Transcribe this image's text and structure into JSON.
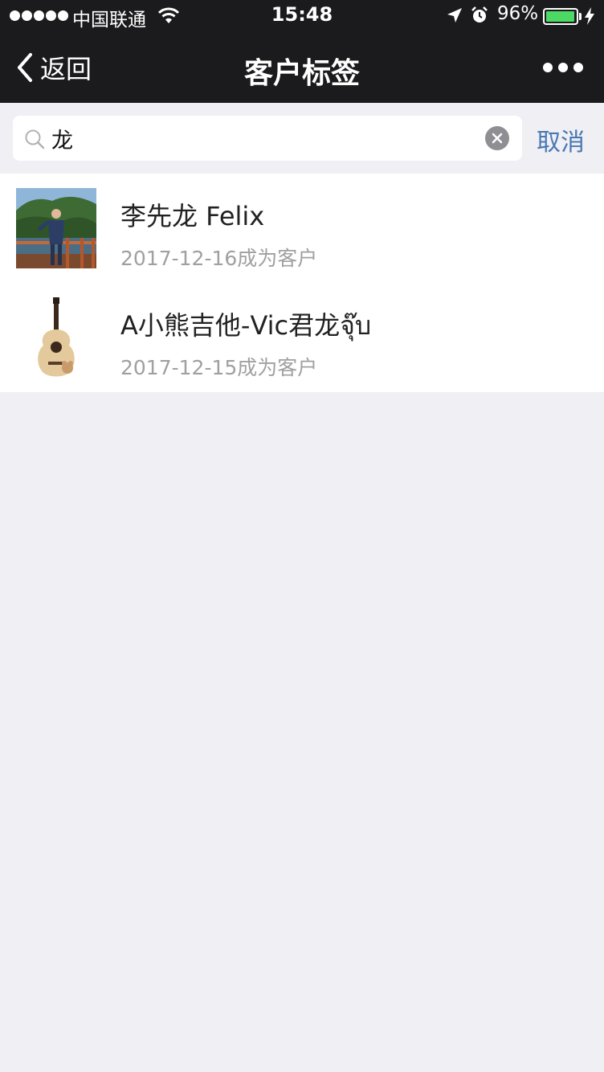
{
  "status_bar": {
    "carrier": "中国联通",
    "time": "15:48",
    "battery_percent": "96%",
    "battery_level": 0.96,
    "icons": [
      "signal-dots-icon",
      "wifi-icon",
      "location-arrow-icon",
      "alarm-icon",
      "battery-icon",
      "charging-bolt-icon"
    ]
  },
  "nav": {
    "back_label": "返回",
    "title": "客户标签",
    "more_icon": "more-dots-icon"
  },
  "search": {
    "query": "龙",
    "cancel_label": "取消"
  },
  "results": [
    {
      "name": "李先龙 Felix",
      "date": "2017-12-16成为客户",
      "avatar": "person-photo"
    },
    {
      "name": "A小熊吉他-Vic君龙จุ๊บ",
      "date": "2017-12-15成为客户",
      "avatar": "guitar-photo"
    }
  ],
  "colors": {
    "nav_bg": "#1b1b1d",
    "page_bg": "#efeff4",
    "accent": "#4a78b3",
    "battery": "#4cd964"
  }
}
